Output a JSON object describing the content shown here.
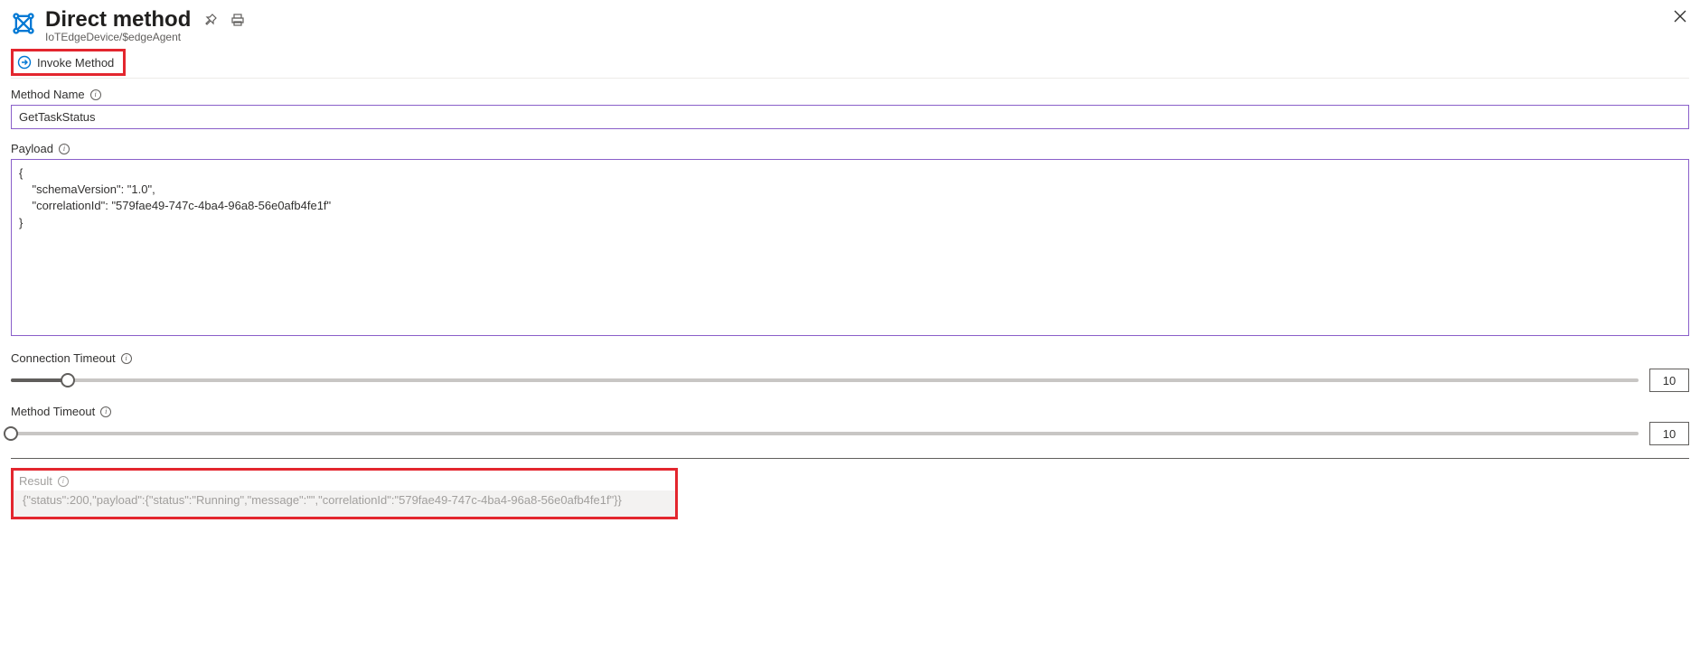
{
  "header": {
    "title": "Direct method",
    "breadcrumb": "IoTEdgeDevice/$edgeAgent"
  },
  "toolbar": {
    "invoke_label": "Invoke Method"
  },
  "fields": {
    "method_name": {
      "label": "Method Name",
      "value": "GetTaskStatus"
    },
    "payload": {
      "label": "Payload",
      "value": "{\n    \"schemaVersion\": \"1.0\",\n    \"correlationId\": \"579fae49-747c-4ba4-96a8-56e0afb4fe1f\"\n}"
    },
    "connection_timeout": {
      "label": "Connection Timeout",
      "value": "10",
      "slider_percent": 3.5
    },
    "method_timeout": {
      "label": "Method Timeout",
      "value": "10",
      "slider_percent": 0
    }
  },
  "result": {
    "label": "Result",
    "value": "{\"status\":200,\"payload\":{\"status\":\"Running\",\"message\":\"\",\"correlationId\":\"579fae49-747c-4ba4-96a8-56e0afb4fe1f\"}}"
  }
}
